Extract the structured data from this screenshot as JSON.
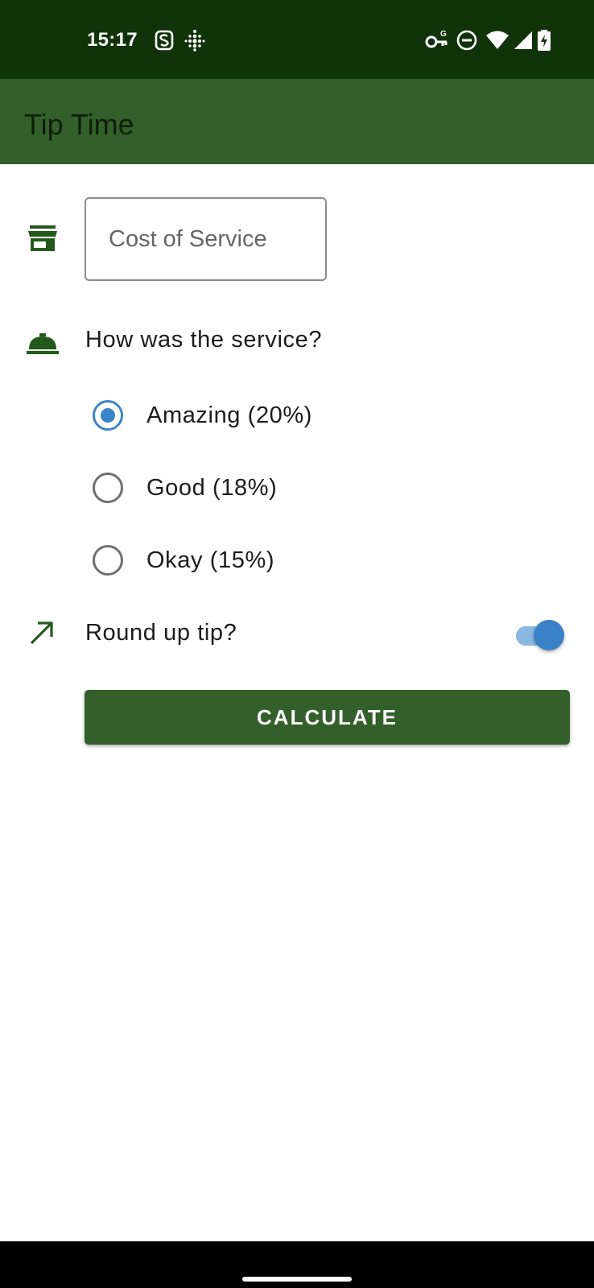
{
  "status_bar": {
    "time": "15:17",
    "left_icons": [
      "notification-s-icon",
      "fitbit-icon"
    ],
    "right_icons": [
      "vpn-key-icon",
      "do-not-disturb-icon",
      "wifi-icon",
      "cell-signal-icon",
      "battery-charging-icon"
    ]
  },
  "app_bar": {
    "title": "Tip Time"
  },
  "cost_field": {
    "placeholder": "Cost of Service",
    "value": "",
    "icon": "storefront-icon"
  },
  "service_question": {
    "label": "How was the service?",
    "icon": "room-service-icon"
  },
  "tip_options": [
    {
      "label": "Amazing (20%)",
      "selected": true
    },
    {
      "label": "Good (18%)",
      "selected": false
    },
    {
      "label": "Okay (15%)",
      "selected": false
    }
  ],
  "round_up": {
    "label": "Round up tip?",
    "enabled": true,
    "icon": "trending-up-icon"
  },
  "calculate_button": {
    "label": "CALCULATE"
  },
  "colors": {
    "status_bar": "#11330a",
    "app_bar": "#33602a",
    "icon_green": "#235a1c",
    "accent_blue": "#3a85c9",
    "button": "#33602a"
  }
}
